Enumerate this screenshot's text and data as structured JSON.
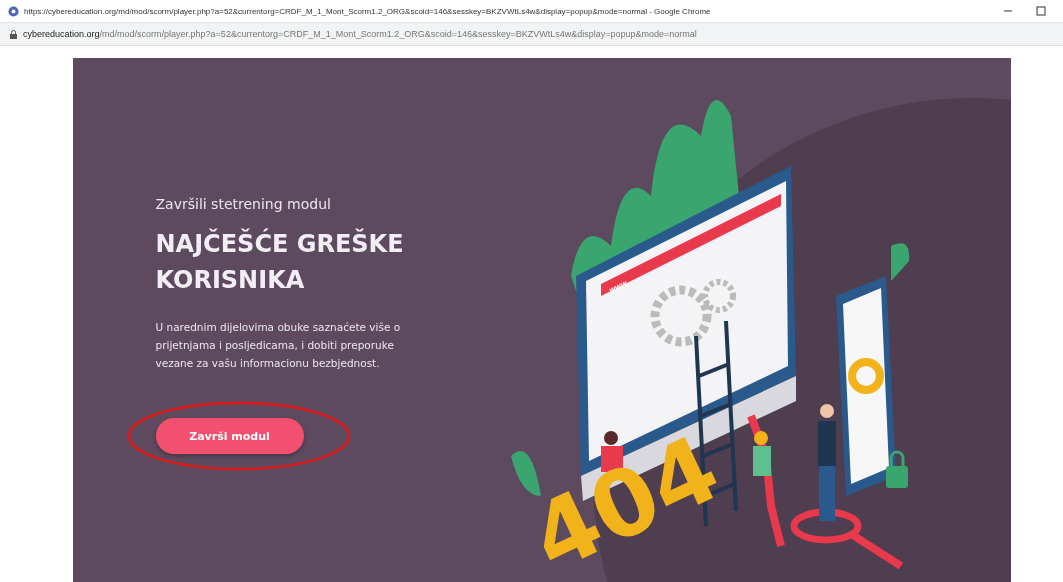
{
  "window": {
    "title": "https://cybereducation.org/md/mod/scorm/player.php?a=52&currentorg=CRDF_M_1_Mont_Scorm1.2_ORG&scoid=146&sesskey=BKZVWtLs4w&display=popup&mode=normal - Google Chrome"
  },
  "address_bar": {
    "domain": "cybereducation.org",
    "path": "/md/mod/scorm/player.php?a=52&currentorg=CRDF_M_1_Mont_Scorm1.2_ORG&scoid=146&sesskey=BKZVWtLs4w&display=popup&mode=normal"
  },
  "slide": {
    "subtitle": "Završili stetrening modul",
    "heading": "NAJČEŠĆE GREŠKE KORISNIKA",
    "body": "U narednim dijelovima obuke saznaćete više o prijetnjama i posljedicama, i dobiti preporuke vezane za vašu informacionu bezbjednost.",
    "button": "Završi modul",
    "button_highlighted": true,
    "illustration": {
      "sign": "404",
      "bar_label": "www"
    }
  }
}
